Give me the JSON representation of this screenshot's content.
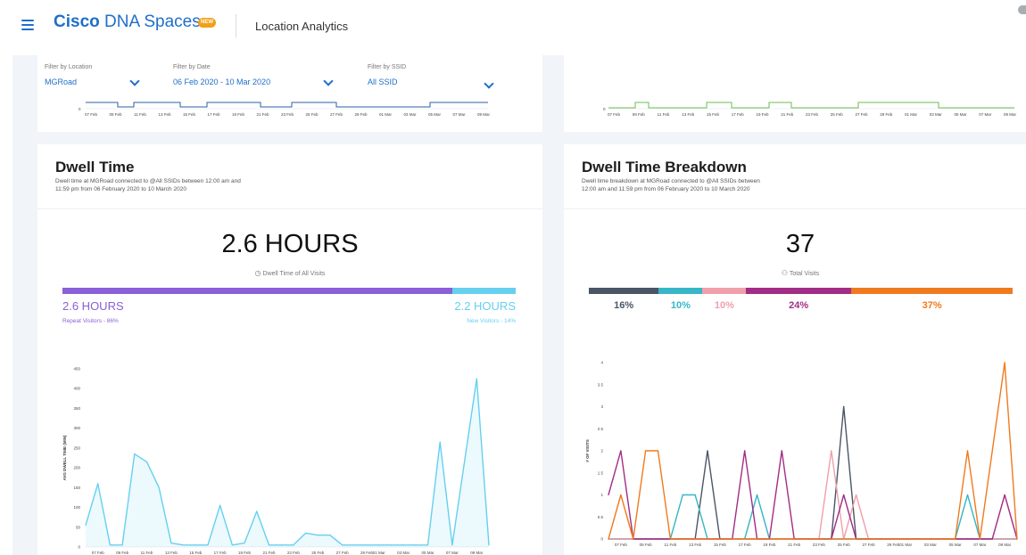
{
  "header": {
    "brand_bold": "Cisco",
    "brand_rest": " DNA Spaces",
    "badge": "NEW",
    "section": "Location Analytics"
  },
  "filters": [
    {
      "label": "Filter by Location",
      "value": "MGRoad"
    },
    {
      "label": "Filter by Date",
      "value": "06 Feb 2020 - 10 Mar 2020"
    },
    {
      "label": "Filter by SSID",
      "value": "All SSID"
    }
  ],
  "mini_ticks_left": [
    "07 Feb",
    "09 Feb",
    "11 Feb",
    "13 Feb",
    "15 Feb",
    "17 Feb",
    "19 Feb",
    "21 Feb",
    "23 Feb",
    "25 Feb",
    "27 Feb",
    "29 Feb",
    "01 Mar",
    "03 Mar",
    "05 Mar",
    "07 Mar",
    "09 Mar"
  ],
  "mini_ticks_right": [
    "07 Feb",
    "09 Feb",
    "11 Feb",
    "13 Feb",
    "15 Feb",
    "17 Feb",
    "19 Feb",
    "21 Feb",
    "23 Feb",
    "25 Feb",
    "27 Feb",
    "29 Feb",
    "01 Mar",
    "03 Mar",
    "05 Mar",
    "07 Mar",
    "09 Mar"
  ],
  "mini_axis_zero": "0",
  "dwell": {
    "title": "Dwell Time",
    "sub1": "Dwell time at MGRoad connected to @All SSIDs between 12:00 am and",
    "sub2": "11:59 pm from 06 February 2020 to 10 March 2020",
    "big": "2.6 HOURS",
    "big_caption": "Dwell Time of All Visits",
    "repeat_value": "2.6 HOURS",
    "repeat_label": "Repeat Visitors - 86%",
    "new_value": "2.2 HOURS",
    "new_label": "New Visitors - 14%",
    "repeat_fraction": 0.86,
    "colors": {
      "repeat": "#8a5fd8",
      "new": "#66d0ef"
    }
  },
  "breakdown": {
    "title": "Dwell Time Breakdown",
    "sub1": "Dwell time breakdown at MGRoad connected to @All SSIDs between",
    "sub2": "12:00 am and 11:59 pm from 06 February 2020 to 10 March 2020",
    "big": "37",
    "big_caption": "Total Visits",
    "segments": [
      {
        "label": "16%",
        "fraction": 0.16,
        "color": "#4a5566"
      },
      {
        "label": "10%",
        "fraction": 0.1,
        "color": "#36b6c7"
      },
      {
        "label": "10%",
        "fraction": 0.1,
        "color": "#efa0aa"
      },
      {
        "label": "24%",
        "fraction": 0.24,
        "color": "#a22d86"
      },
      {
        "label": "37%",
        "fraction": 0.37,
        "color": "#f07a1e"
      }
    ]
  },
  "chart_data": [
    {
      "type": "area",
      "ylabel": "AVG DWELL TIME (MIN)",
      "ylim": [
        0,
        450
      ],
      "yticks": [
        "0",
        "50",
        "100",
        "150",
        "200",
        "250",
        "300",
        "350",
        "400",
        "450"
      ],
      "x": [
        "06 Feb",
        "07 Feb",
        "08 Feb",
        "09 Feb",
        "10 Feb",
        "11 Feb",
        "12 Feb",
        "13 Feb",
        "14 Feb",
        "15 Feb",
        "16 Feb",
        "17 Feb",
        "18 Feb",
        "19 Feb",
        "20 Feb",
        "21 Feb",
        "22 Feb",
        "23 Feb",
        "24 Feb",
        "25 Feb",
        "26 Feb",
        "27 Feb",
        "28 Feb",
        "29 Feb",
        "01 Mar",
        "02 Mar",
        "03 Mar",
        "04 Mar",
        "05 Mar",
        "06 Mar",
        "07 Mar",
        "08 Mar",
        "09 Mar",
        "10 Mar"
      ],
      "xticks": [
        "07 Feb",
        "09 Feb",
        "11 Feb",
        "13 Feb",
        "15 Feb",
        "17 Feb",
        "19 Feb",
        "21 Feb",
        "23 Feb",
        "25 Feb",
        "27 Feb",
        "29 Feb",
        "01 Mar",
        "03 Mar",
        "05 Mar",
        "07 Mar",
        "09 Mar"
      ],
      "series": [
        {
          "values": [
            55,
            160,
            5,
            5,
            235,
            215,
            150,
            10,
            5,
            5,
            5,
            105,
            5,
            10,
            90,
            5,
            5,
            5,
            35,
            30,
            30,
            5,
            5,
            5,
            5,
            5,
            5,
            5,
            5,
            265,
            5,
            215,
            425,
            5
          ],
          "color": "#66d0ef"
        }
      ]
    },
    {
      "type": "line",
      "ylabel": "# OF VISITS",
      "ylim": [
        0,
        4
      ],
      "yticks": [
        "0",
        "0.5",
        "1",
        "1.5",
        "2",
        "2.5",
        "3",
        "3.5",
        "4"
      ],
      "x": [
        "06 Feb",
        "07 Feb",
        "08 Feb",
        "09 Feb",
        "10 Feb",
        "11 Feb",
        "12 Feb",
        "13 Feb",
        "14 Feb",
        "15 Feb",
        "16 Feb",
        "17 Feb",
        "18 Feb",
        "19 Feb",
        "20 Feb",
        "21 Feb",
        "22 Feb",
        "23 Feb",
        "24 Feb",
        "25 Feb",
        "26 Feb",
        "27 Feb",
        "28 Feb",
        "29 Feb",
        "01 Mar",
        "02 Mar",
        "03 Mar",
        "04 Mar",
        "05 Mar",
        "06 Mar",
        "07 Mar",
        "08 Mar",
        "09 Mar",
        "10 Mar"
      ],
      "xticks": [
        "07 Feb",
        "09 Feb",
        "11 Feb",
        "13 Feb",
        "15 Feb",
        "17 Feb",
        "19 Feb",
        "21 Feb",
        "23 Feb",
        "25 Feb",
        "27 Feb",
        "29 Feb",
        "01 Mar",
        "03 Mar",
        "05 Mar",
        "07 Mar",
        "09 Mar"
      ],
      "series": [
        {
          "values": [
            0,
            0,
            0,
            0,
            0,
            0,
            0,
            0,
            2,
            0,
            0,
            0,
            0,
            0,
            0,
            0,
            0,
            0,
            0,
            3,
            0,
            0,
            0,
            0,
            0,
            0,
            0,
            0,
            0,
            0,
            0,
            0,
            0,
            0
          ],
          "color": "#4a5566"
        },
        {
          "values": [
            0,
            0,
            0,
            0,
            0,
            0,
            1,
            1,
            0,
            0,
            0,
            0,
            1,
            0,
            0,
            0,
            0,
            0,
            0,
            0,
            0,
            0,
            0,
            0,
            0,
            0,
            0,
            0,
            0,
            1,
            0,
            0,
            0,
            0
          ],
          "color": "#36b6c7"
        },
        {
          "values": [
            0,
            0,
            0,
            0,
            0,
            0,
            0,
            0,
            0,
            0,
            0,
            0,
            0,
            0,
            0,
            0,
            0,
            0,
            2,
            0,
            1,
            0,
            0,
            0,
            0,
            0,
            0,
            0,
            0,
            0,
            0,
            0,
            0,
            0
          ],
          "color": "#efa0aa"
        },
        {
          "values": [
            1,
            2,
            0,
            0,
            0,
            0,
            0,
            0,
            0,
            0,
            0,
            2,
            0,
            0,
            2,
            0,
            0,
            0,
            0,
            1,
            0,
            0,
            0,
            0,
            0,
            0,
            0,
            0,
            0,
            0,
            0,
            0,
            1,
            0
          ],
          "color": "#a22d86"
        },
        {
          "values": [
            0,
            1,
            0,
            2,
            2,
            0,
            0,
            0,
            0,
            0,
            0,
            0,
            0,
            0,
            0,
            0,
            0,
            0,
            0,
            0,
            0,
            0,
            0,
            0,
            0,
            0,
            0,
            0,
            0,
            2,
            0,
            2,
            4,
            0
          ],
          "color": "#f07a1e"
        }
      ]
    }
  ]
}
